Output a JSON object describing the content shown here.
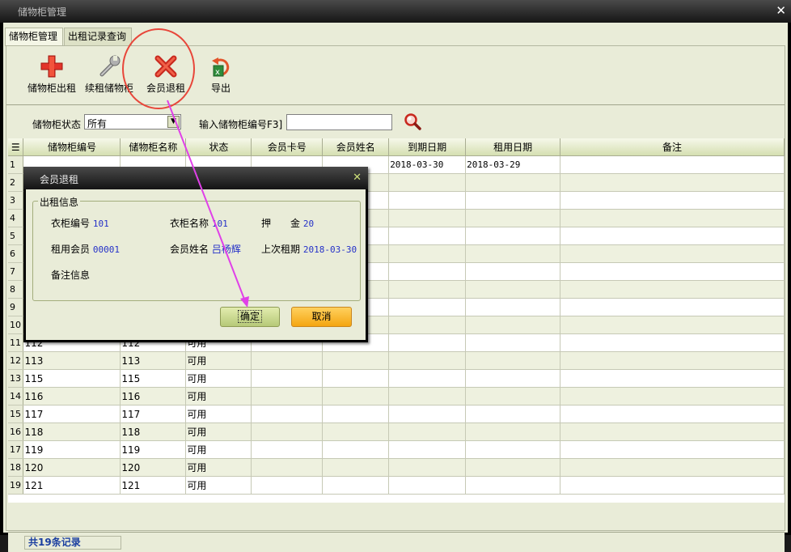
{
  "window": {
    "title": "储物柜管理"
  },
  "tabs": [
    {
      "label": "储物柜管理",
      "active": true
    },
    {
      "label": "出租记录查询",
      "active": false
    }
  ],
  "toolbar": {
    "rent_label": "储物柜出租",
    "renew_label": "续租储物柜",
    "return_label": "会员退租",
    "export_label": "导出"
  },
  "filter": {
    "status_label": "储物柜状态",
    "status_value": "所有",
    "code_label": "输入储物柜编号F3]",
    "code_value": ""
  },
  "grid": {
    "columns": [
      "储物柜编号",
      "储物柜名称",
      "状态",
      "会员卡号",
      "会员姓名",
      "到期日期",
      "租用日期",
      "备注"
    ],
    "rows": [
      {
        "index": "1",
        "cells": [
          "",
          "",
          "",
          "",
          "",
          "2018-03-30",
          "2018-03-29",
          ""
        ]
      },
      {
        "index": "2",
        "cells": [
          "",
          "",
          "",
          "",
          "",
          "",
          "",
          ""
        ]
      },
      {
        "index": "3",
        "cells": [
          "",
          "",
          "",
          "",
          "",
          "",
          "",
          ""
        ]
      },
      {
        "index": "4",
        "cells": [
          "",
          "",
          "",
          "",
          "",
          "",
          "",
          ""
        ]
      },
      {
        "index": "5",
        "cells": [
          "",
          "",
          "",
          "",
          "",
          "",
          "",
          ""
        ]
      },
      {
        "index": "6",
        "cells": [
          "",
          "",
          "",
          "",
          "",
          "",
          "",
          ""
        ]
      },
      {
        "index": "7",
        "cells": [
          "",
          "",
          "",
          "",
          "",
          "",
          "",
          ""
        ]
      },
      {
        "index": "8",
        "cells": [
          "",
          "",
          "",
          "",
          "",
          "",
          "",
          ""
        ]
      },
      {
        "index": "9",
        "cells": [
          "",
          "",
          "",
          "",
          "",
          "",
          "",
          ""
        ]
      },
      {
        "index": "10",
        "cells": [
          "",
          "",
          "",
          "",
          "",
          "",
          "",
          ""
        ]
      },
      {
        "index": "11",
        "cells": [
          "112",
          "112",
          "可用",
          "",
          "",
          "",
          "",
          ""
        ]
      },
      {
        "index": "12",
        "cells": [
          "113",
          "113",
          "可用",
          "",
          "",
          "",
          "",
          ""
        ]
      },
      {
        "index": "13",
        "cells": [
          "115",
          "115",
          "可用",
          "",
          "",
          "",
          "",
          ""
        ]
      },
      {
        "index": "14",
        "cells": [
          "116",
          "116",
          "可用",
          "",
          "",
          "",
          "",
          ""
        ]
      },
      {
        "index": "15",
        "cells": [
          "117",
          "117",
          "可用",
          "",
          "",
          "",
          "",
          ""
        ]
      },
      {
        "index": "16",
        "cells": [
          "118",
          "118",
          "可用",
          "",
          "",
          "",
          "",
          ""
        ]
      },
      {
        "index": "17",
        "cells": [
          "119",
          "119",
          "可用",
          "",
          "",
          "",
          "",
          ""
        ]
      },
      {
        "index": "18",
        "cells": [
          "120",
          "120",
          "可用",
          "",
          "",
          "",
          "",
          ""
        ]
      },
      {
        "index": "19",
        "cells": [
          "121",
          "121",
          "可用",
          "",
          "",
          "",
          "",
          ""
        ]
      }
    ]
  },
  "status": {
    "record_count": "共19条记录"
  },
  "dialog": {
    "title": "会员退租",
    "group_label": "出租信息",
    "locker_code_label": "衣柜编号",
    "locker_code": "101",
    "locker_name_label": "衣柜名称",
    "locker_name": "101",
    "deposit_label": "押　　金",
    "deposit": "20",
    "member_label": "租用会员",
    "member": "00001",
    "member_name_label": "会员姓名",
    "member_name": "吕杨辉",
    "last_rent_label": "上次租期",
    "last_rent": "2018-03-30",
    "remark_label": "备注信息",
    "ok_label": "确定",
    "cancel_label": "取消"
  },
  "colors": {
    "highlight_circle": "#e8463a",
    "arrow": "#e040e8",
    "value_text": "#2430c8"
  }
}
